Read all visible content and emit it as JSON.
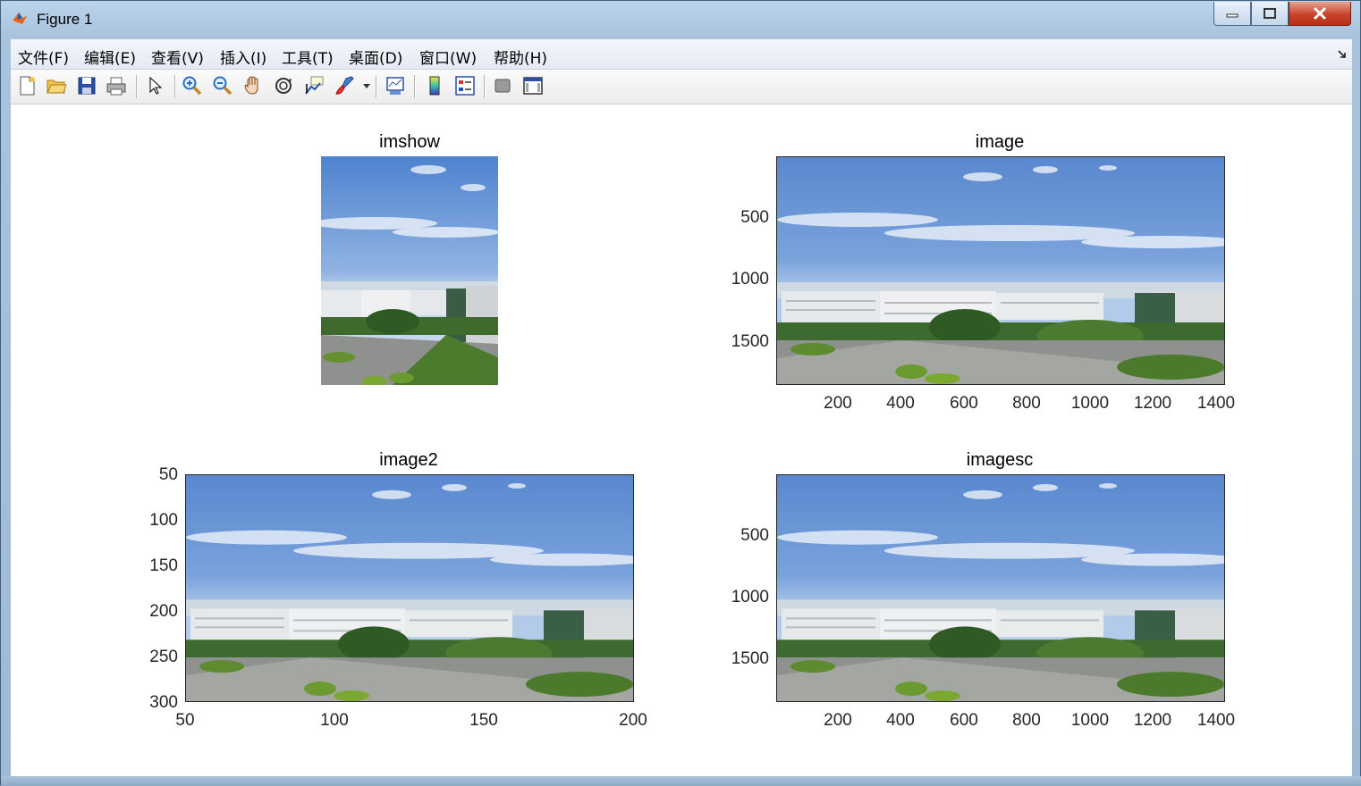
{
  "window": {
    "title": "Figure 1",
    "icon": "matlab-icon",
    "controls": [
      "minimize",
      "maximize",
      "close"
    ]
  },
  "menubar": {
    "items": [
      "文件(F)",
      "编辑(E)",
      "查看(V)",
      "插入(I)",
      "工具(T)",
      "桌面(D)",
      "窗口(W)",
      "帮助(H)"
    ]
  },
  "toolbar": {
    "buttons": [
      "new-figure-icon",
      "open-file-icon",
      "save-icon",
      "print-icon",
      "select-arrow-icon",
      "zoom-in-icon",
      "zoom-out-icon",
      "pan-hand-icon",
      "rotate-3d-icon",
      "data-cursor-icon",
      "brush-icon",
      "brush-dropdown-icon",
      "link-plot-icon",
      "colorbar-icon",
      "legend-icon",
      "hide-plot-tools-icon",
      "show-plot-tools-icon"
    ]
  },
  "subplots": [
    {
      "title": "imshow",
      "yticks": [],
      "xticks": []
    },
    {
      "title": "image",
      "yticks": [
        "500",
        "1000",
        "1500"
      ],
      "xticks": [
        "200",
        "400",
        "600",
        "800",
        "1000",
        "1200",
        "1400"
      ]
    },
    {
      "title": "image2",
      "yticks": [
        "50",
        "100",
        "150",
        "200",
        "250",
        "300"
      ],
      "xticks": [
        "50",
        "100",
        "150",
        "200"
      ]
    },
    {
      "title": "imagesc",
      "yticks": [
        "500",
        "1000",
        "1500"
      ],
      "xticks": [
        "200",
        "400",
        "600",
        "800",
        "1000",
        "1200",
        "1400"
      ]
    }
  ],
  "colors": {
    "sky_top": "#5f8fd3",
    "sky_bottom": "#a7c3e8",
    "building": "#e9ecef",
    "trees": "#3f6b2a",
    "road": "#8a8d8a"
  }
}
